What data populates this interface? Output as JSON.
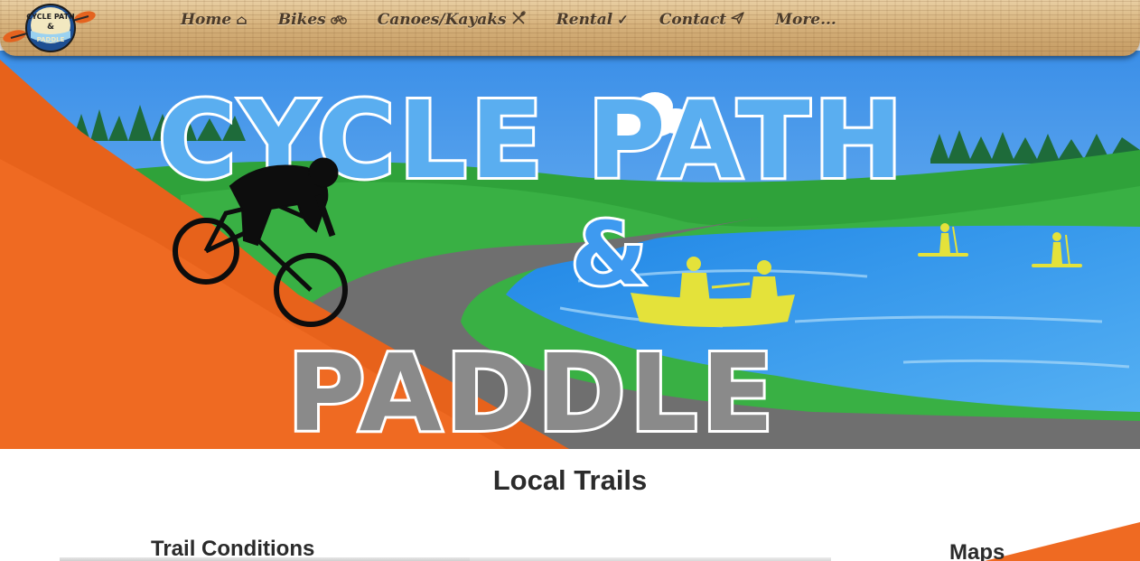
{
  "site": {
    "logo_text_top": "CYCLE PATH",
    "logo_text_mid": "&",
    "logo_text_bottom": "PADDLE"
  },
  "nav": {
    "items": [
      {
        "label": "Home",
        "icon": "home-icon",
        "glyph": "⌂"
      },
      {
        "label": "Bikes",
        "icon": "bicycle-icon",
        "glyph": "⚲"
      },
      {
        "label": "Canoes/Kayaks",
        "icon": "paddle-icon",
        "glyph": "✕"
      },
      {
        "label": "Rental",
        "icon": "checkmark-icon",
        "glyph": "✓"
      },
      {
        "label": "Contact",
        "icon": "paper-plane-icon",
        "glyph": "➤"
      },
      {
        "label": "More...",
        "icon": "",
        "glyph": ""
      }
    ]
  },
  "hero": {
    "title_line1": "CYCLE PATH",
    "title_amp": "&",
    "title_line2": "PADDLE",
    "colors": {
      "sky": "#3f9bf0",
      "grass": "#2fa23a",
      "path_orange": "#ef6a22",
      "road": "#777777",
      "lake": "#2b8fe6",
      "canoe_yellow": "#e7e53a"
    }
  },
  "content": {
    "section_title": "Local Trails",
    "trail_conditions_heading": "Trail Conditions",
    "maps_heading": "Maps"
  }
}
